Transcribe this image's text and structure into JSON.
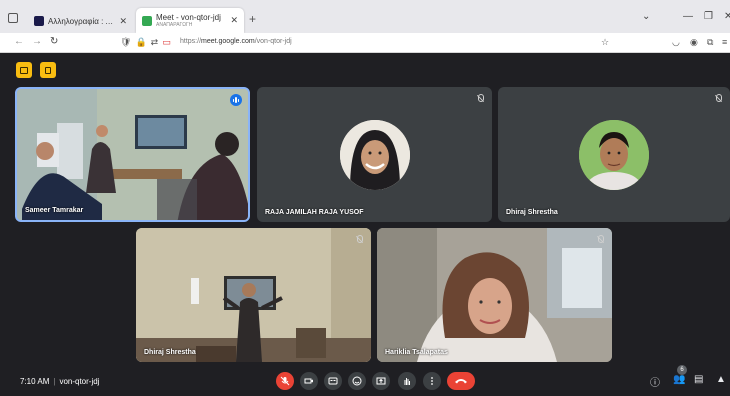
{
  "browser": {
    "tabs": [
      {
        "title": "Αλληλογραφία : Αποστέλμενα",
        "active": false
      },
      {
        "title": "Meet - von-qtor-jdj",
        "subtitle": "ΑΝΑΠΑΡΑΓΩΓΗ",
        "active": true
      }
    ],
    "url_host": "meet.google.com",
    "url_prefix": "https://",
    "url_path": "/von-qtor-jdj"
  },
  "participants": [
    {
      "name": "Sameer Tamrakar",
      "speaking": true
    },
    {
      "name": "RAJA JAMILAH RAJA YUSOF",
      "muted": true
    },
    {
      "name": "Dhiraj Shrestha",
      "muted": true
    },
    {
      "name": "Dhiraj Shrestha",
      "muted": true
    },
    {
      "name": "Hariklia Tsalapatas",
      "muted": true
    }
  ],
  "meeting": {
    "time": "7:10 AM",
    "code": "von-qtor-jdj",
    "people_count": "6"
  },
  "colors": {
    "accent": "#8ab4f8",
    "end_call": "#ea4335",
    "activity": "#f9bd11"
  }
}
